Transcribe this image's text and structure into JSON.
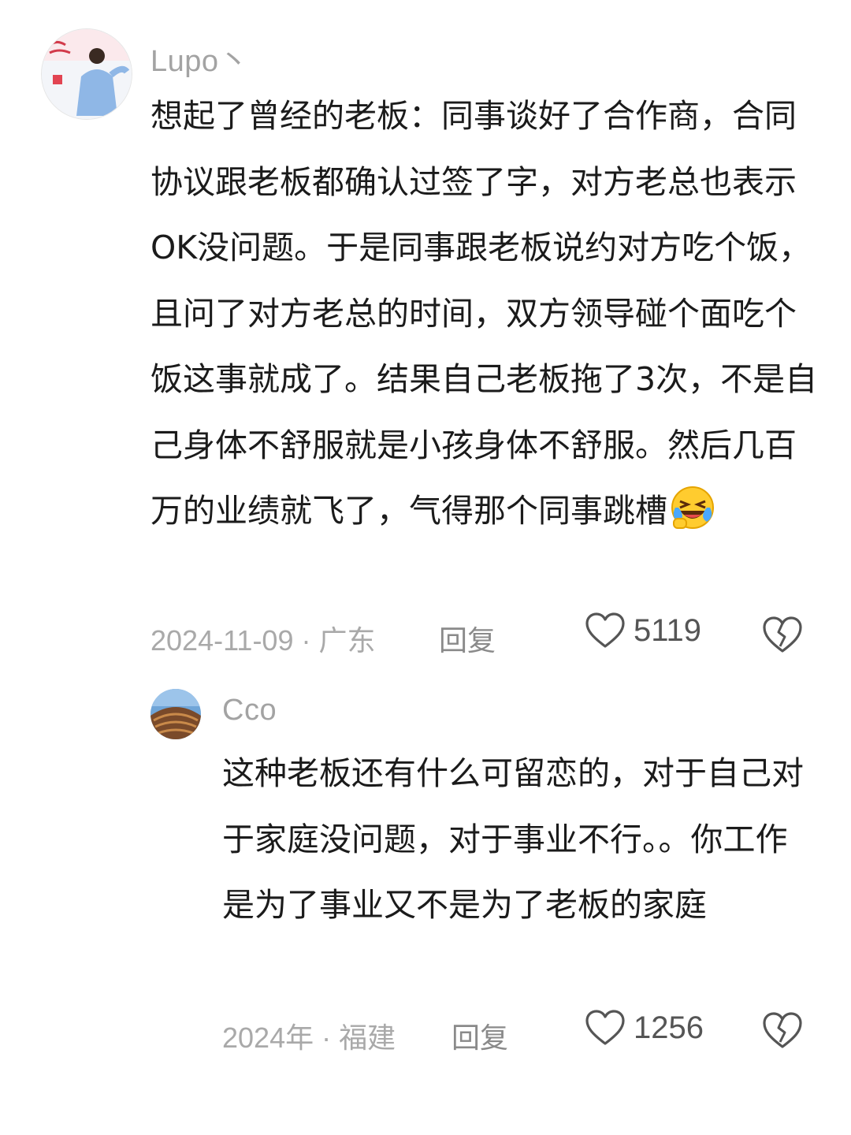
{
  "comments": [
    {
      "username": "Lupo丶",
      "avatar_icon": "user-photo-avatar",
      "text": "想起了曾经的老板：同事谈好了合作商，合同协议跟老板都确认过签了字，对方老总也表示OK没问题。于是同事跟老板说约对方吃个饭，且问了对方老总的时间，双方领导碰个面吃个饭这事就成了。结果自己老板拖了3次，不是自己身体不舒服就是小孩身体不舒服。然后几百万的业绩就飞了，气得那个同事跳槽",
      "emoji": "laughing-crying-emoji",
      "date": "2024-11-09",
      "location": "广东",
      "meta": "2024-11-09 · 广东",
      "reply_label": "回复",
      "like_count": "5119"
    },
    {
      "username": "Cco",
      "avatar_icon": "building-photo-avatar",
      "text": "这种老板还有什么可留恋的，对于自己对于家庭没问题，对于事业不行。。你工作是为了事业又不是为了老板的家庭",
      "date": "2024年",
      "location": "福建",
      "meta": "2024年 · 福建",
      "reply_label": "回复",
      "like_count": "1256"
    }
  ],
  "colors": {
    "text": "#1b1b1b",
    "meta": "#a9a9a9",
    "username": "#a3a3a3"
  }
}
